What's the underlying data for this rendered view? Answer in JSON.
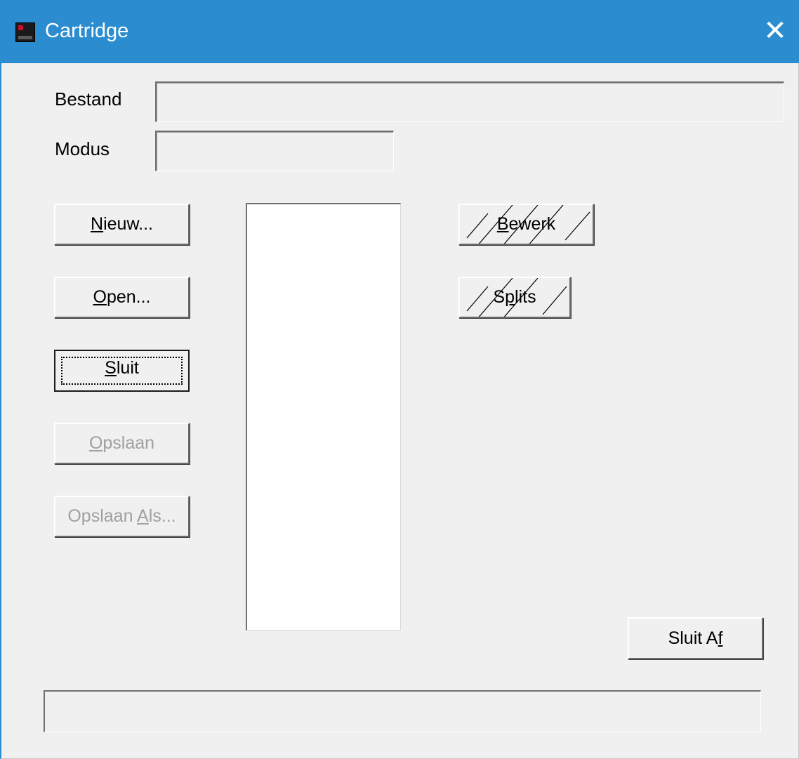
{
  "window": {
    "title": "Cartridge",
    "close_glyph": "✕",
    "app_icon": "cartridge-app-icon",
    "titlebar_color": "#2b8dd0"
  },
  "fields": {
    "bestand_label": "Bestand",
    "bestand_value": "",
    "modus_label": "Modus",
    "modus_value": ""
  },
  "buttons": {
    "nieuw": {
      "label": "Nieuw...",
      "mnemonic": "N",
      "rest": "ieuw...",
      "enabled": true
    },
    "open": {
      "label": "Open...",
      "mnemonic": "O",
      "rest": "pen...",
      "enabled": true
    },
    "sluit": {
      "label": "Sluit",
      "mnemonic": "S",
      "rest": "luit",
      "enabled": true,
      "default": true
    },
    "opslaan": {
      "label": "Opslaan",
      "mnemonic": "O",
      "rest": "pslaan",
      "enabled": false
    },
    "opslaan_als": {
      "label": "Opslaan Als...",
      "prefix": "Opslaan ",
      "mnemonic": "A",
      "rest": "ls...",
      "enabled": false
    },
    "bewerk": {
      "label": "Bewerk",
      "mnemonic": "B",
      "rest": "ewerk",
      "hatched": true
    },
    "splits": {
      "label": "Splits",
      "prefix": "S",
      "mnemonic": "p",
      "rest": "lits",
      "hatched": true
    },
    "sluit_af": {
      "label": "Sluit Af",
      "prefix": "Sluit A",
      "mnemonic": "f",
      "rest": "",
      "enabled": true
    }
  },
  "listbox": {
    "items": []
  },
  "statusbar": {
    "text": ""
  }
}
